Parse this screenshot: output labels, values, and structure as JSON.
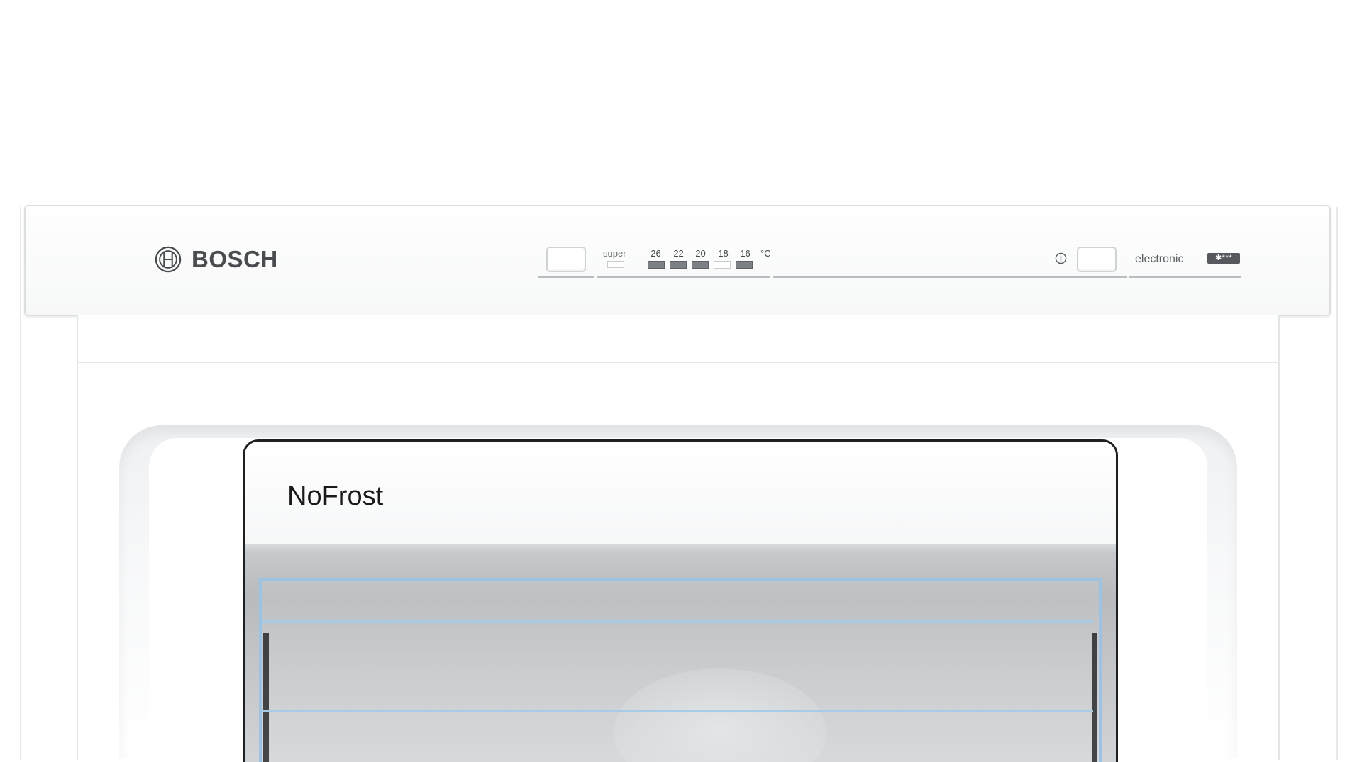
{
  "brand": {
    "name": "BOSCH"
  },
  "control_panel": {
    "super_label": "super",
    "temperatures": [
      "-26",
      "-22",
      "-20",
      "-18",
      "-16"
    ],
    "unit": "°C",
    "active_temperature": "-18",
    "electronic_label": "electronic",
    "star_rating": "✱***"
  },
  "drawer": {
    "label": "NoFrost"
  }
}
